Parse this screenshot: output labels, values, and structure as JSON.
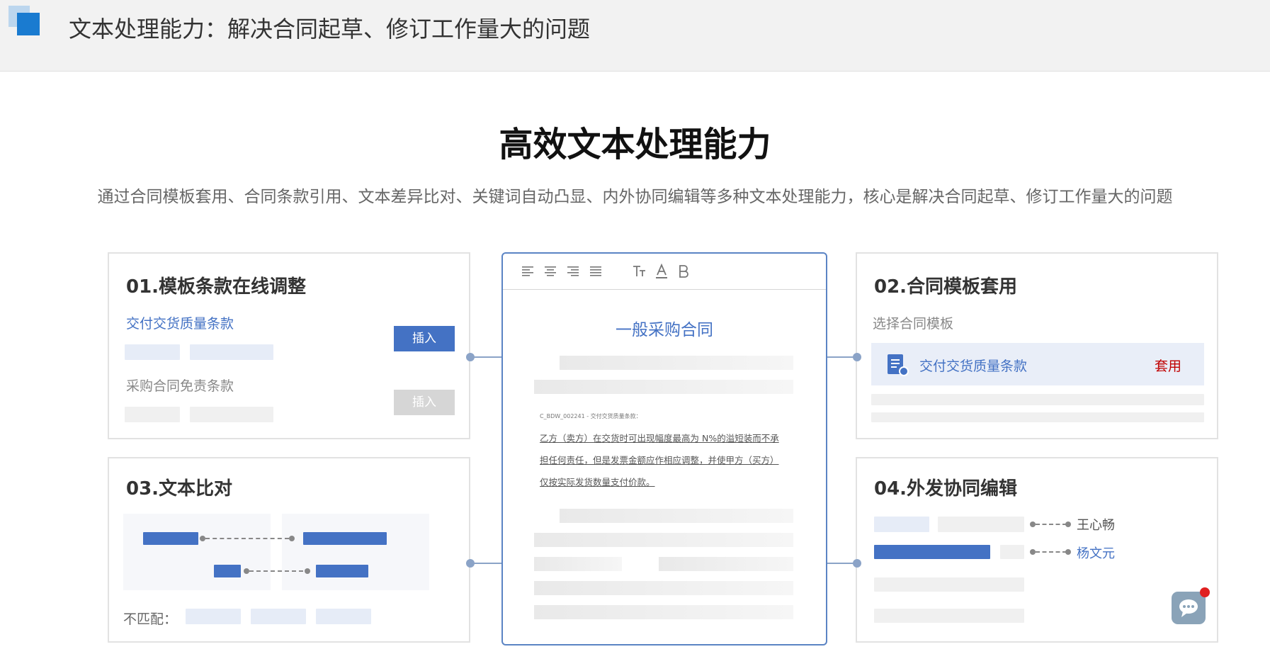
{
  "header": {
    "title": "文本处理能力：解决合同起草、修订工作量大的问题"
  },
  "main": {
    "title": "高效文本处理能力",
    "subtitle": "通过合同模板套用、合同条款引用、文本差异比对、关键词自动凸显、内外协同编辑等多种文本处理能力，核心是解决合同起草、修订工作量大的问题"
  },
  "card1": {
    "title": "01.模板条款在线调整",
    "item1_label": "交付交货质量条款",
    "item1_button": "插入",
    "item2_label": "采购合同免责条款",
    "item2_button": "插入"
  },
  "card2": {
    "title": "02.合同模板套用",
    "select_label": "选择合同模板",
    "template_name": "交付交货质量条款",
    "apply_label": "套用"
  },
  "card3": {
    "title": "03.文本比对",
    "mismatch_label": "不匹配："
  },
  "card4": {
    "title": "04.外发协同编辑",
    "user1": "王心畅",
    "user2": "杨文元"
  },
  "doc": {
    "toolbar": [
      "align-left-icon",
      "align-center-icon",
      "align-right-icon",
      "align-justify-icon",
      "text-size-icon",
      "font-color-icon",
      "bold-icon"
    ],
    "title": "一般采购合同",
    "clause_ref": "C_BDW_002241 - 交付交货质量条款：",
    "clause_lines": [
      "乙方（卖方）在交货时可出现幅度最高为 N%的溢短装而不承",
      "担任何责任，但是发票金额应作相应调整，并使甲方（买方）",
      "仅按实际发货数量支付价款。"
    ]
  },
  "colors": {
    "accent": "#4472c4",
    "doc_border": "#5b84c4",
    "apply": "#c00000",
    "notification": "#e02020"
  }
}
